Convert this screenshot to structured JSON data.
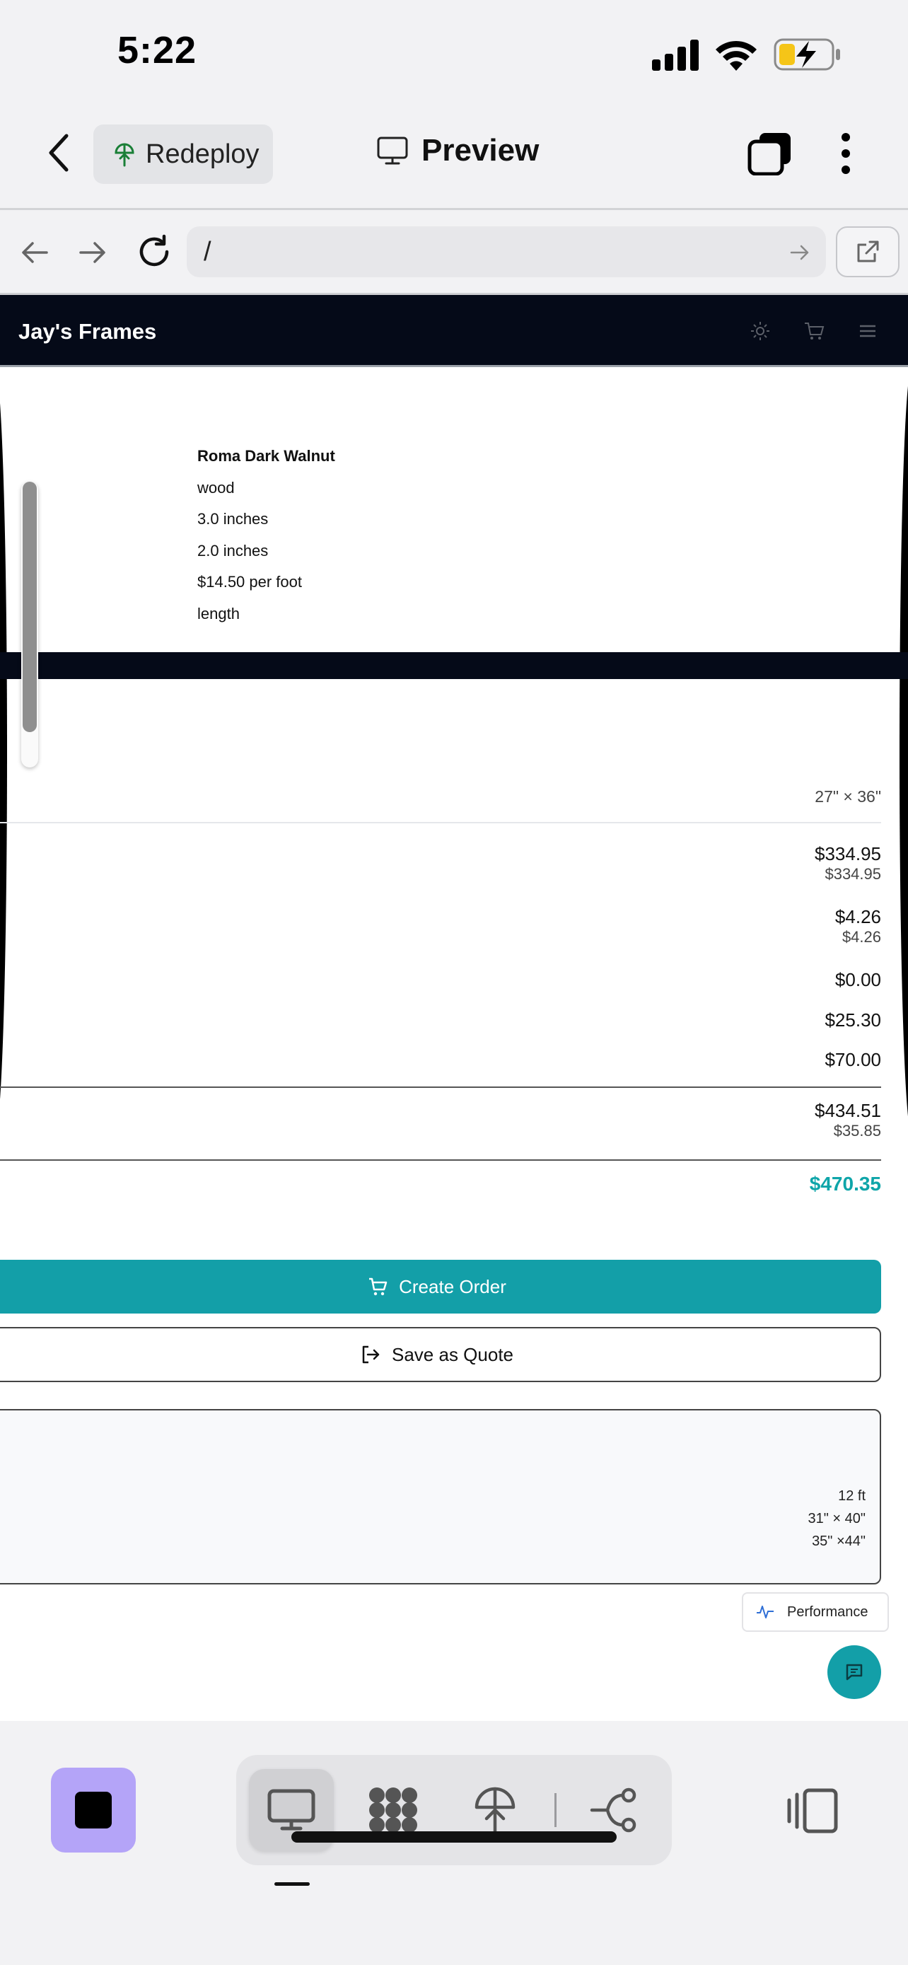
{
  "status_bar": {
    "time": "5:22"
  },
  "app_bar": {
    "redeploy_label": "Redeploy",
    "title": "Preview"
  },
  "browser": {
    "url": "/"
  },
  "site": {
    "brand": "Jay's Frames",
    "frame": {
      "name": "Roma Dark Walnut",
      "material": "wood",
      "width": "3.0 inches",
      "depth": "2.0 inches",
      "price": "$14.50 per foot",
      "unit": "length"
    },
    "size": "27\" × 36\"",
    "prices": [
      {
        "main": "$334.95",
        "sub": "$334.95"
      },
      {
        "main": "$4.26",
        "sub": "$4.26"
      },
      {
        "main": "$0.00"
      },
      {
        "main": "$25.30"
      },
      {
        "main": "$70.00"
      }
    ],
    "subtotal": {
      "main": "$434.51",
      "sub": "$35.85"
    },
    "total": "$470.35",
    "create_order_label": "Create Order",
    "save_quote_label": "Save as Quote",
    "summary": {
      "line1": "12 ft",
      "line2": "31\" × 40\"",
      "line3": "35\" ×44\""
    },
    "performance_label": "Performance"
  },
  "colors": {
    "accent": "#139fa8",
    "total_color": "#0ea5a9",
    "site_header": "#050a18",
    "stop_button": "#b4a4f8"
  }
}
